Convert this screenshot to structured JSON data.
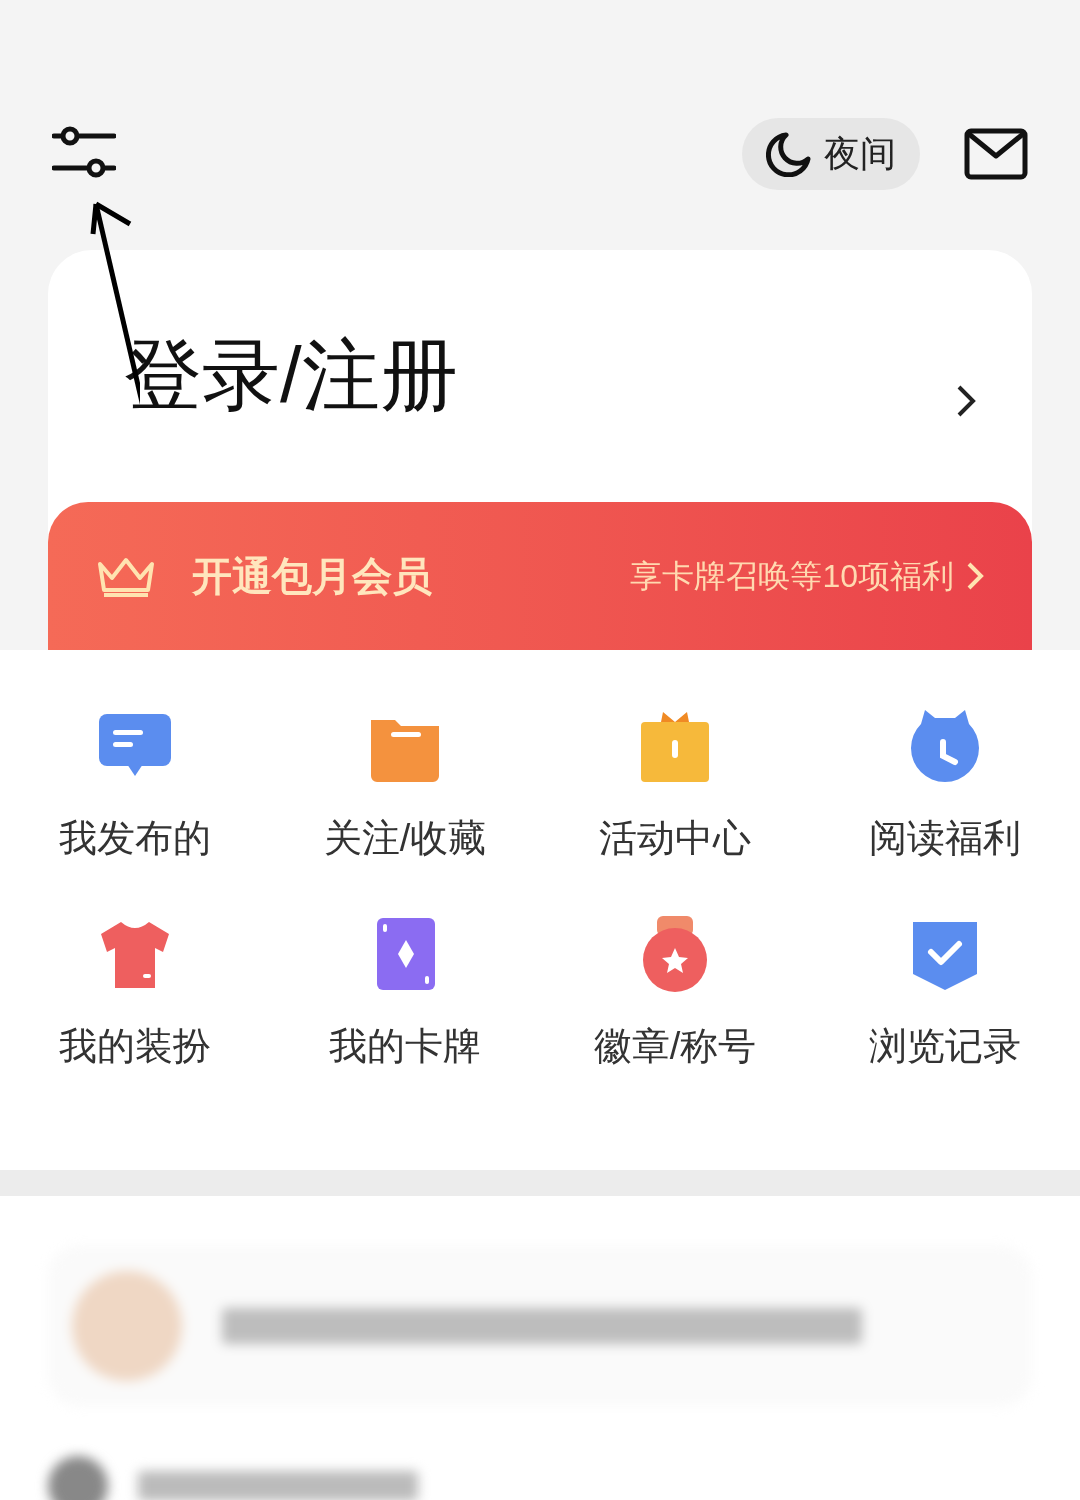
{
  "header": {
    "night_mode": {
      "label": "夜间"
    }
  },
  "login": {
    "title": "登录/注册"
  },
  "vip_banner": {
    "title": "开通包月会员",
    "benefit": "享卡牌召唤等10项福利"
  },
  "menu": [
    {
      "label": "我发布的",
      "kind": "message"
    },
    {
      "label": "关注/收藏",
      "kind": "folder"
    },
    {
      "label": "活动中心",
      "kind": "gift"
    },
    {
      "label": "阅读福利",
      "kind": "clock"
    },
    {
      "label": "我的装扮",
      "kind": "shirt"
    },
    {
      "label": "我的卡牌",
      "kind": "card"
    },
    {
      "label": "徽章/称号",
      "kind": "medal"
    },
    {
      "label": "浏览记录",
      "kind": "history"
    }
  ]
}
